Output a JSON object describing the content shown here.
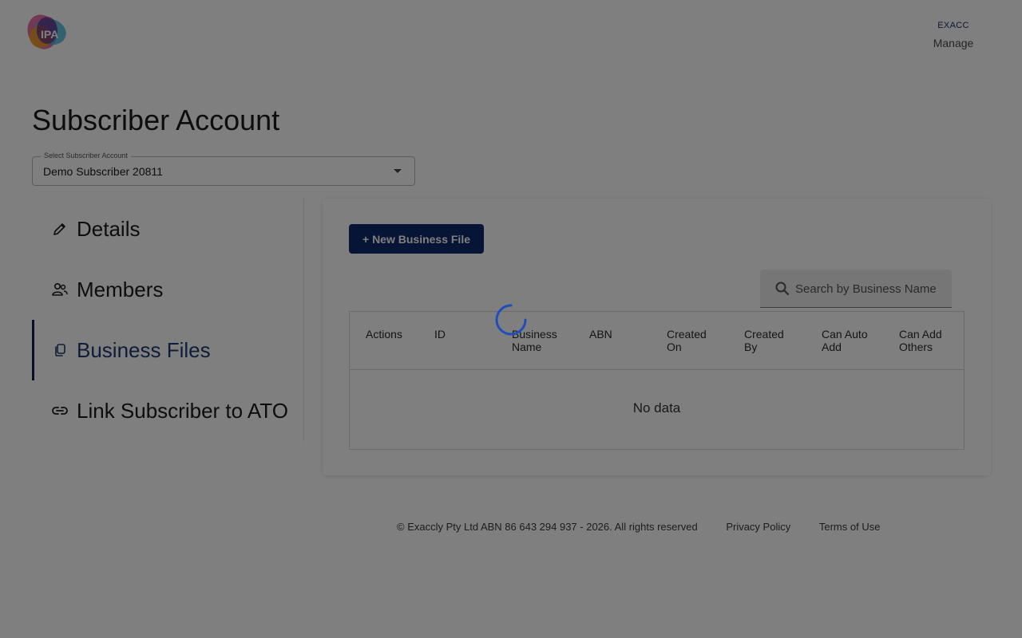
{
  "header": {
    "logo_text": "IPA",
    "user_initials": "EXACC",
    "manage_label": "Manage"
  },
  "page": {
    "title": "Subscriber Account"
  },
  "subscriber_select": {
    "label": "Select Subscriber Account",
    "value": "Demo Subscriber 20811"
  },
  "sidebar": {
    "items": [
      {
        "label": "Details",
        "icon": "pencil-icon",
        "active": false
      },
      {
        "label": "Members",
        "icon": "people-icon",
        "active": false
      },
      {
        "label": "Business Files",
        "icon": "copy-files-icon",
        "active": true
      },
      {
        "label": "Link Subscriber to ATO",
        "icon": "link-icon",
        "active": false
      }
    ]
  },
  "business_files": {
    "new_button_label": "+ New Business File",
    "search_placeholder": "Search by Business Name",
    "columns": [
      "Actions",
      "ID",
      "Business Name",
      "ABN",
      "Created On",
      "Created By",
      "Can Auto Add",
      "Can Add Others"
    ],
    "empty_text": "No data"
  },
  "footer": {
    "copyright": "© Exaccly Pty Ltd ABN 86 643 294 937 - 2026. All rights reserved",
    "privacy_label": "Privacy Policy",
    "terms_label": "Terms of Use"
  },
  "colors": {
    "primary": "#0d2b6b",
    "active_nav": "#1f3a72",
    "overlay": "rgba(0,0,0,0.5)"
  }
}
